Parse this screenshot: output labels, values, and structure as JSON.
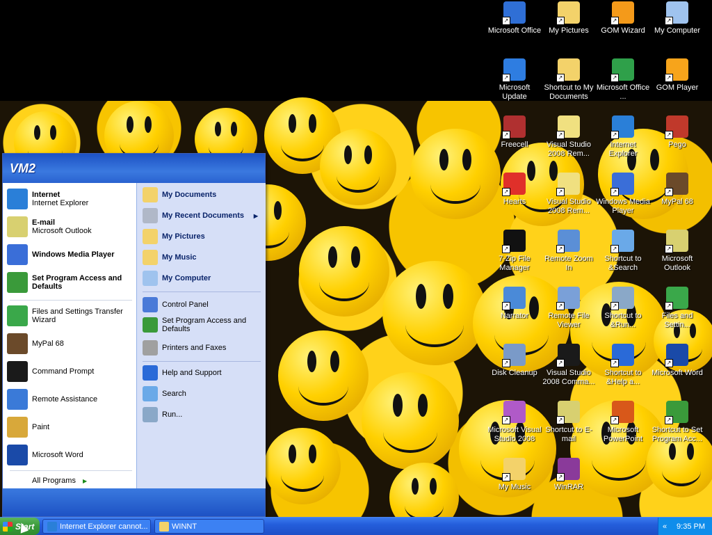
{
  "desktop": {
    "icons": [
      {
        "label": "Microsoft Office",
        "icon": "office-icon",
        "color": "#2f6fd6"
      },
      {
        "label": "My Pictures",
        "icon": "folder-pictures-icon",
        "color": "#f3d26a"
      },
      {
        "label": "GOM Wizard",
        "icon": "gom-wizard-icon",
        "color": "#f49a1a"
      },
      {
        "label": "My Computer",
        "icon": "computer-icon",
        "color": "#9fc3ee"
      },
      {
        "label": "Microsoft Update",
        "icon": "update-icon",
        "color": "#2e7de1"
      },
      {
        "label": "Shortcut to My Documents",
        "icon": "folder-documents-icon",
        "color": "#f3d26a"
      },
      {
        "label": "Microsoft Office ...",
        "icon": "office-tools-icon",
        "color": "#2fa04a"
      },
      {
        "label": "GOM Player",
        "icon": "gom-player-icon",
        "color": "#f7a41b"
      },
      {
        "label": "Freecell",
        "icon": "freecell-icon",
        "color": "#b03030"
      },
      {
        "label": "Visual Studio 2008 Rem...",
        "icon": "visual-studio-icon",
        "color": "#f0e080"
      },
      {
        "label": "Internet Explorer",
        "icon": "internet-explorer-icon",
        "color": "#2a7fd8"
      },
      {
        "label": "Pego",
        "icon": "pego-icon",
        "color": "#c0392b"
      },
      {
        "label": "Hearts",
        "icon": "hearts-icon",
        "color": "#e0302a"
      },
      {
        "label": "Visual Studio 2008 Rem...",
        "icon": "visual-studio-icon",
        "color": "#f0e080"
      },
      {
        "label": "Windows Media Player",
        "icon": "media-player-icon",
        "color": "#3a6ed8"
      },
      {
        "label": "MyPal 68",
        "icon": "mypal-icon",
        "color": "#6b4a2a"
      },
      {
        "label": "7-Zip File Manager",
        "icon": "seven-zip-icon",
        "color": "#111111"
      },
      {
        "label": "Remote Zoom In",
        "icon": "magnifier-icon",
        "color": "#5b8fd6"
      },
      {
        "label": "Shortcut to &Search",
        "icon": "search-icon",
        "color": "#6aa9e8"
      },
      {
        "label": "Microsoft Outlook",
        "icon": "outlook-icon",
        "color": "#d8d070"
      },
      {
        "label": "Narrator",
        "icon": "narrator-icon",
        "color": "#4a8ad8"
      },
      {
        "label": "Remote File Viewer",
        "icon": "file-viewer-icon",
        "color": "#7aa0d8"
      },
      {
        "label": "Shortcut to &Run...",
        "icon": "run-icon",
        "color": "#8aa8c8"
      },
      {
        "label": "Files and Settin...",
        "icon": "files-transfer-icon",
        "color": "#3aa84a"
      },
      {
        "label": "Disk Cleanup",
        "icon": "disk-cleanup-icon",
        "color": "#7a9ac8"
      },
      {
        "label": "Visual Studio 2008 Comma...",
        "icon": "command-prompt-icon",
        "color": "#1a1a1a"
      },
      {
        "label": "Shortcut to &Help a...",
        "icon": "help-icon",
        "color": "#2a6ad8"
      },
      {
        "label": "Microsoft Word",
        "icon": "word-icon",
        "color": "#1a4aa8"
      },
      {
        "label": "Microsoft Visual Studio 2008",
        "icon": "visual-studio-icon",
        "color": "#b05ac8"
      },
      {
        "label": "Shortcut to E-mail",
        "icon": "email-icon",
        "color": "#d8d070"
      },
      {
        "label": "Microsoft PowerPoint",
        "icon": "powerpoint-icon",
        "color": "#d8581a"
      },
      {
        "label": "Shortcut to Set Program Acc...",
        "icon": "set-program-access-icon",
        "color": "#3a9a3a"
      },
      {
        "label": "My Music",
        "icon": "folder-music-icon",
        "color": "#f3d26a"
      },
      {
        "label": "WinRAR",
        "icon": "winrar-icon",
        "color": "#8a3a9a"
      }
    ]
  },
  "start_menu": {
    "user": "VM2",
    "pinned": [
      {
        "title": "Internet",
        "subtitle": "Internet Explorer",
        "icon": "internet-explorer-icon",
        "color": "#2a7fd8"
      },
      {
        "title": "E-mail",
        "subtitle": "Microsoft Outlook",
        "icon": "outlook-icon",
        "color": "#d8d070"
      },
      {
        "title": "Windows Media Player",
        "subtitle": "",
        "icon": "media-player-icon",
        "color": "#3a6ed8"
      },
      {
        "title": "Set Program Access and Defaults",
        "subtitle": "",
        "icon": "set-program-access-icon",
        "color": "#3a9a3a"
      }
    ],
    "recent": [
      {
        "label": "Files and Settings Transfer Wizard",
        "icon": "files-transfer-icon",
        "color": "#3aa84a"
      },
      {
        "label": "MyPal 68",
        "icon": "mypal-icon",
        "color": "#6b4a2a"
      },
      {
        "label": "Command Prompt",
        "icon": "command-prompt-icon",
        "color": "#1a1a1a"
      },
      {
        "label": "Remote Assistance",
        "icon": "remote-assistance-icon",
        "color": "#3a7ad8"
      },
      {
        "label": "Paint",
        "icon": "paint-icon",
        "color": "#d8a83a"
      },
      {
        "label": "Microsoft Word",
        "icon": "word-icon",
        "color": "#1a4aa8"
      }
    ],
    "all_programs": "All Programs",
    "places": [
      {
        "label": "My Documents",
        "icon": "folder-documents-icon",
        "color": "#f3d26a",
        "arrow": ""
      },
      {
        "label": "My Recent Documents",
        "icon": "recent-documents-icon",
        "color": "#b0b8c8",
        "arrow": "▶"
      },
      {
        "label": "My Pictures",
        "icon": "folder-pictures-icon",
        "color": "#f3d26a",
        "arrow": ""
      },
      {
        "label": "My Music",
        "icon": "folder-music-icon",
        "color": "#f3d26a",
        "arrow": ""
      },
      {
        "label": "My Computer",
        "icon": "computer-icon",
        "color": "#9fc3ee",
        "arrow": ""
      }
    ],
    "settings": [
      {
        "label": "Control Panel",
        "icon": "control-panel-icon",
        "color": "#4a7ad8"
      },
      {
        "label": "Set Program Access and Defaults",
        "icon": "set-program-access-icon",
        "color": "#3a9a3a"
      },
      {
        "label": "Printers and Faxes",
        "icon": "printer-icon",
        "color": "#a0a0a0"
      }
    ],
    "tools": [
      {
        "label": "Help and Support",
        "icon": "help-icon",
        "color": "#2a6ad8"
      },
      {
        "label": "Search",
        "icon": "search-icon",
        "color": "#6aa9e8"
      },
      {
        "label": "Run...",
        "icon": "run-icon",
        "color": "#8aa8c8"
      }
    ]
  },
  "taskbar": {
    "start_label": "Start",
    "tasks": [
      {
        "label": "Internet Explorer cannot...",
        "icon": "internet-explorer-icon",
        "color": "#2a7fd8"
      },
      {
        "label": "WINNT",
        "icon": "folder-icon",
        "color": "#f3d26a"
      }
    ],
    "tray_chevron": "«",
    "clock": "9:35 PM"
  },
  "colors": {
    "start_header": "#2a62d0",
    "start_button": "#3a9a3a",
    "taskbar": "#245edb",
    "tray": "#0f8deb"
  }
}
